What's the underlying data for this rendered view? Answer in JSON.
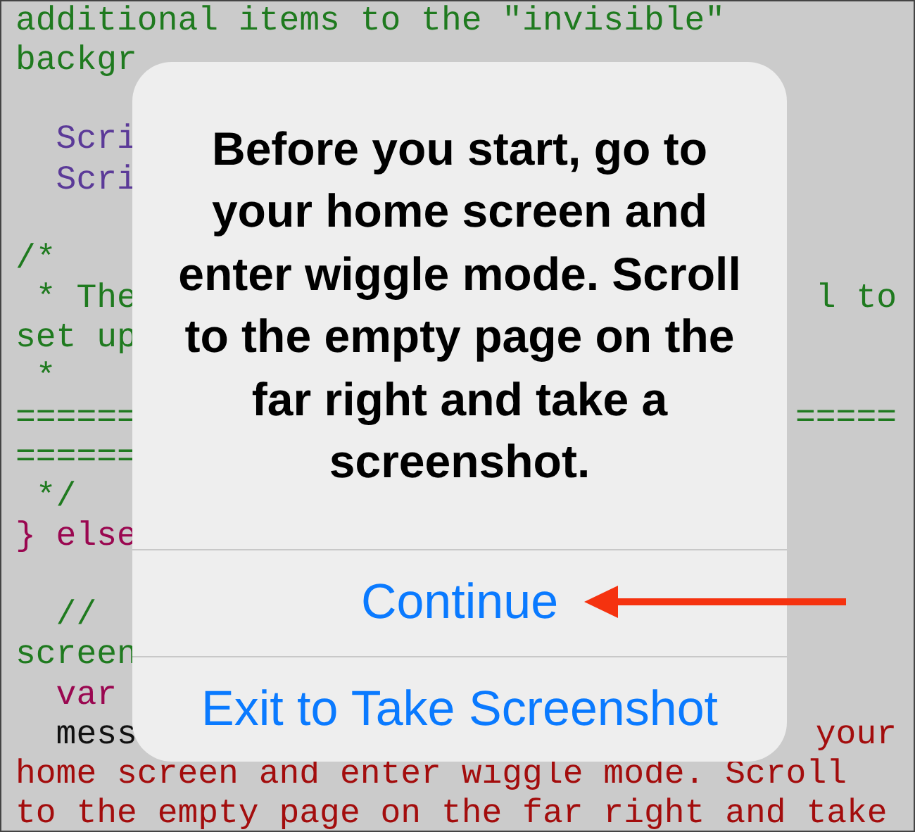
{
  "code_editor": {
    "lines": [
      {
        "start": {
          "text": "additional items to the \"invisible\"",
          "kind": "comment"
        }
      },
      {
        "start": {
          "text": "backgr",
          "kind": "comment"
        }
      },
      {
        "kind": "blank"
      },
      {
        "start": {
          "text": "  Scri",
          "kind": "type"
        }
      },
      {
        "start": {
          "text": "  Scri",
          "kind": "type"
        }
      },
      {
        "kind": "blank"
      },
      {
        "start": {
          "text": "/*",
          "kind": "comment"
        }
      },
      {
        "start": {
          "text": " * The",
          "kind": "comment"
        },
        "end": {
          "text": "l to",
          "kind": "comment"
        }
      },
      {
        "start": {
          "text": "set up",
          "kind": "comment"
        }
      },
      {
        "start": {
          "text": " *",
          "kind": "comment"
        }
      },
      {
        "start": {
          "text": "======",
          "kind": "comment"
        },
        "end": {
          "text": "=====",
          "kind": "comment"
        }
      },
      {
        "start": {
          "text": "======",
          "kind": "comment"
        }
      },
      {
        "start": {
          "text": " */",
          "kind": "comment"
        }
      },
      {
        "start": {
          "text": "} else",
          "kind": "keyword"
        }
      },
      {
        "kind": "blank"
      },
      {
        "start": {
          "text": "  //",
          "kind": "comment"
        }
      },
      {
        "start": {
          "text": "screen",
          "kind": "comment"
        }
      },
      {
        "start": {
          "text": "  var",
          "kind": "keyword"
        }
      },
      {
        "start": {
          "text": "  mess",
          "kind": "plain"
        },
        "end": {
          "text": "your",
          "kind": "string"
        }
      },
      {
        "start": {
          "text": "home screen and enter wiggle mode. Scroll",
          "kind": "string"
        }
      },
      {
        "start": {
          "text": "to the empty page on the far right and take",
          "kind": "string"
        }
      }
    ]
  },
  "alert": {
    "message": "Before you start, go to your home screen and enter wiggle mode. Scroll to the empty page on the far right and take a screenshot.",
    "actions": [
      {
        "label": "Continue"
      },
      {
        "label": "Exit to Take Screenshot"
      }
    ]
  },
  "annotation": {
    "kind": "arrow"
  }
}
